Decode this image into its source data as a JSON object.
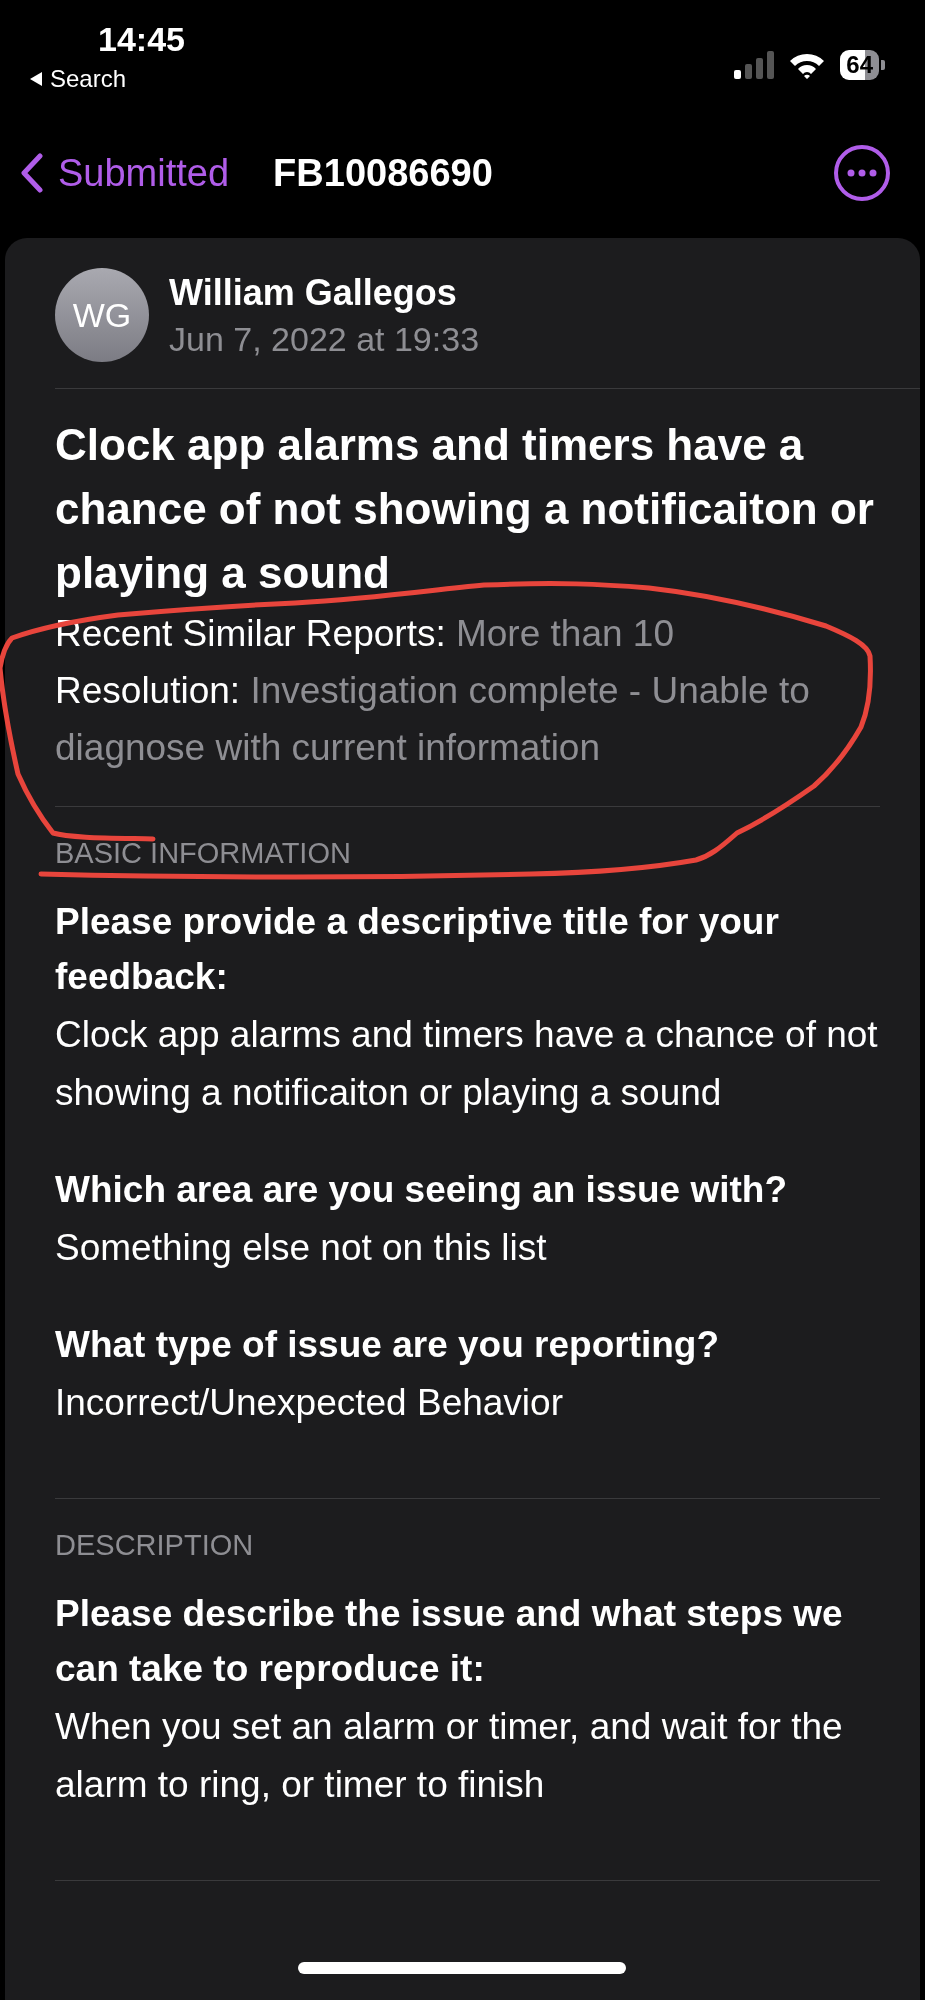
{
  "status_bar": {
    "time": "14:45",
    "back_label": "Search",
    "battery": "64"
  },
  "nav": {
    "back": "Submitted",
    "title": "FB10086690"
  },
  "author": {
    "initials": "WG",
    "name": "William Gallegos",
    "date": "Jun 7, 2022 at 19:33"
  },
  "report": {
    "title": "Clock app alarms and timers have a chance of not showing a notificaiton or playing a sound",
    "details": [
      {
        "label": "Recent Similar Reports:",
        "value": "More than 10"
      },
      {
        "label": "Resolution:",
        "value": "Investigation complete - Unable to diagnose with current information"
      }
    ]
  },
  "sections": [
    {
      "heading": "BASIC INFORMATION",
      "items": [
        {
          "question": "Please provide a descriptive title for your feedback:",
          "answer": "Clock app alarms and timers have a chance of not showing a notificaiton or playing a sound"
        },
        {
          "question": "Which area are you seeing an issue with?",
          "answer": "Something else not on this list"
        },
        {
          "question": "What type of issue are you reporting?",
          "answer": "Incorrect/Unexpected Behavior"
        }
      ]
    },
    {
      "heading": "DESCRIPTION",
      "items": [
        {
          "question": "Please describe the issue and what steps we can take to reproduce it:",
          "answer": "When you set an alarm or timer, and wait for the alarm to ring, or timer to finish"
        }
      ]
    }
  ]
}
